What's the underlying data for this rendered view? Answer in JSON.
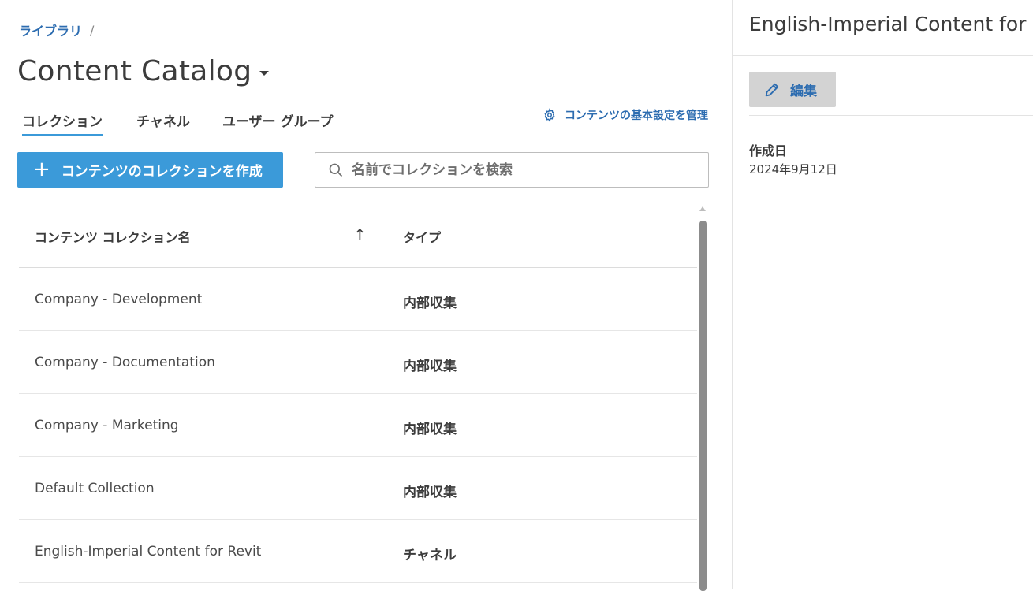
{
  "breadcrumb": {
    "library": "ライブラリ",
    "separator": "/"
  },
  "page_title": "Content Catalog",
  "tabs": [
    {
      "label": "コレクション",
      "active": true
    },
    {
      "label": "チャネル",
      "active": false
    },
    {
      "label": "ユーザー グループ",
      "active": false
    }
  ],
  "manage_link": "コンテンツの基本設定を管理",
  "create_button": "コンテンツのコレクションを作成",
  "search": {
    "placeholder": "名前でコレクションを検索"
  },
  "table": {
    "headers": {
      "name": "コンテンツ コレクション名",
      "type": "タイプ"
    },
    "rows": [
      {
        "name": "Company - Development",
        "type": "内部収集"
      },
      {
        "name": "Company - Documentation",
        "type": "内部収集"
      },
      {
        "name": "Company - Marketing",
        "type": "内部収集"
      },
      {
        "name": "Default Collection",
        "type": "内部収集"
      },
      {
        "name": "English-Imperial Content for Revit",
        "type": "チャネル"
      }
    ]
  },
  "detail": {
    "title": "English-Imperial Content for Revit",
    "edit_label": "編集",
    "created_label": "作成日",
    "created_value": "2024年9月12日"
  },
  "colors": {
    "accent": "#3b9ad9",
    "link": "#2c6cb0"
  }
}
